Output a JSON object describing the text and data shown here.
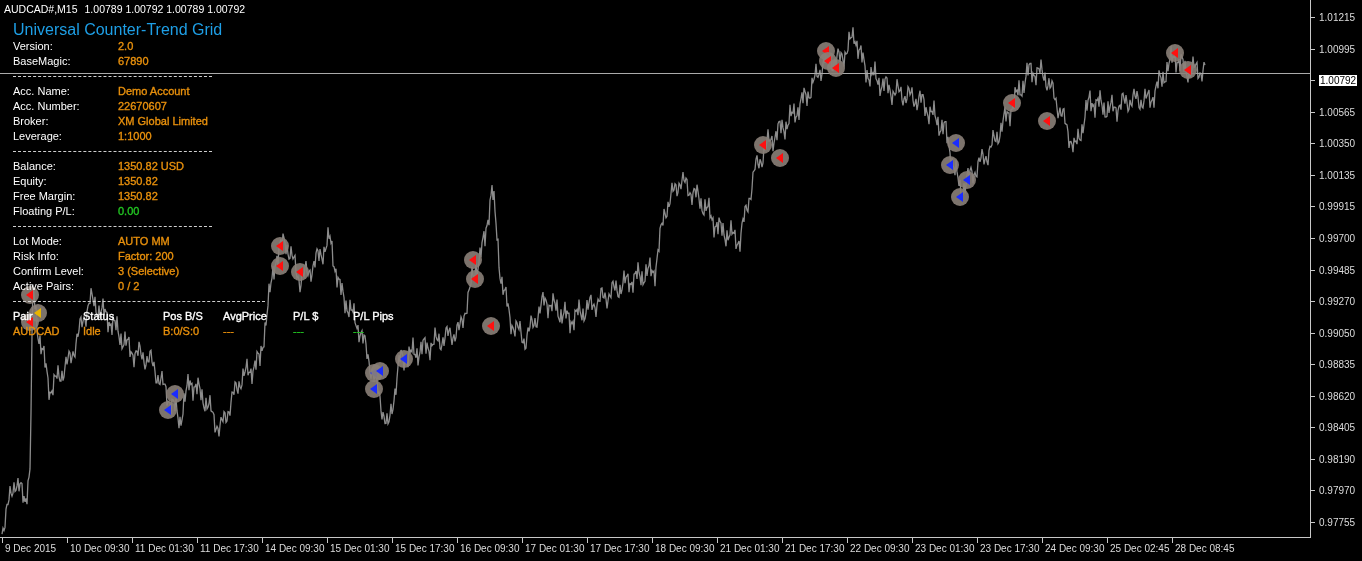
{
  "chart_header": {
    "symbol": "AUDCAD#,M15",
    "quotes": "1.00789 1.00792 1.00789 1.00792"
  },
  "panel": {
    "title": "Universal Counter-Trend Grid",
    "sections": [
      [
        {
          "label": "Version:",
          "value": "2.0",
          "color": "#e8900c"
        },
        {
          "label": "BaseMagic:",
          "value": "67890",
          "color": "#e8900c"
        }
      ],
      [
        {
          "label": "Acc. Name:",
          "value": "Demo Account",
          "color": "#e8900c"
        },
        {
          "label": "Acc. Number:",
          "value": "22670607",
          "color": "#e8900c"
        },
        {
          "label": "Broker:",
          "value": "XM Global Limited",
          "color": "#e8900c"
        },
        {
          "label": "Leverage:",
          "value": "1:1000",
          "color": "#e8900c"
        }
      ],
      [
        {
          "label": "Balance:",
          "value": "1350.82 USD",
          "color": "#e8900c"
        },
        {
          "label": "Equity:",
          "value": "1350.82",
          "color": "#e8900c"
        },
        {
          "label": "Free Margin:",
          "value": "1350.82",
          "color": "#e8900c"
        },
        {
          "label": "Floating P/L:",
          "value": "0.00",
          "color": "#22c422"
        }
      ],
      [
        {
          "label": "Lot Mode:",
          "value": "AUTO MM",
          "color": "#e8900c"
        },
        {
          "label": "Risk Info:",
          "value": "Factor: 200",
          "color": "#e8900c"
        },
        {
          "label": "Confirm Level:",
          "value": "3 (Selective)",
          "color": "#e8900c"
        },
        {
          "label": "Active Pairs:",
          "value": "0 / 2",
          "color": "#e8900c"
        }
      ]
    ]
  },
  "table": {
    "columns": [
      "Pair",
      "Status",
      "Pos B/S",
      "AvgPrice",
      "P/L $",
      "P/L Pips"
    ],
    "rows": [
      {
        "cells": [
          {
            "text": "AUDCAD",
            "color": "#e8900c"
          },
          {
            "text": "Idle",
            "color": "#e8900c"
          },
          {
            "text": "B:0/S:0",
            "color": "#e8900c"
          },
          {
            "text": "---",
            "color": "#e8900c"
          },
          {
            "text": "---",
            "color": "#22c422"
          },
          {
            "text": "---",
            "color": "#22c422"
          }
        ]
      }
    ]
  },
  "price_axis": {
    "labels": [
      {
        "text": "1.01215",
        "current": false
      },
      {
        "text": "1.00995",
        "current": false
      },
      {
        "text": "1.00792",
        "current": true
      },
      {
        "text": "1.00565",
        "current": false
      },
      {
        "text": "1.00350",
        "current": false
      },
      {
        "text": "1.00135",
        "current": false
      },
      {
        "text": "0.99915",
        "current": false
      },
      {
        "text": "0.99700",
        "current": false
      },
      {
        "text": "0.99485",
        "current": false
      },
      {
        "text": "0.99270",
        "current": false
      },
      {
        "text": "0.99050",
        "current": false
      },
      {
        "text": "0.98835",
        "current": false
      },
      {
        "text": "0.98620",
        "current": false
      },
      {
        "text": "0.98405",
        "current": false
      },
      {
        "text": "0.98190",
        "current": false
      },
      {
        "text": "0.97970",
        "current": false
      },
      {
        "text": "0.97755",
        "current": false
      }
    ]
  },
  "time_axis": {
    "labels": [
      "9 Dec 2015",
      "10 Dec 09:30",
      "11 Dec 01:30",
      "11 Dec 17:30",
      "14 Dec 09:30",
      "15 Dec 01:30",
      "15 Dec 17:30",
      "16 Dec 09:30",
      "17 Dec 01:30",
      "17 Dec 17:30",
      "18 Dec 09:30",
      "21 Dec 01:30",
      "21 Dec 17:30",
      "22 Dec 09:30",
      "23 Dec 01:30",
      "23 Dec 17:30",
      "24 Dec 09:30",
      "25 Dec 02:45",
      "28 Dec 08:45"
    ]
  }
}
